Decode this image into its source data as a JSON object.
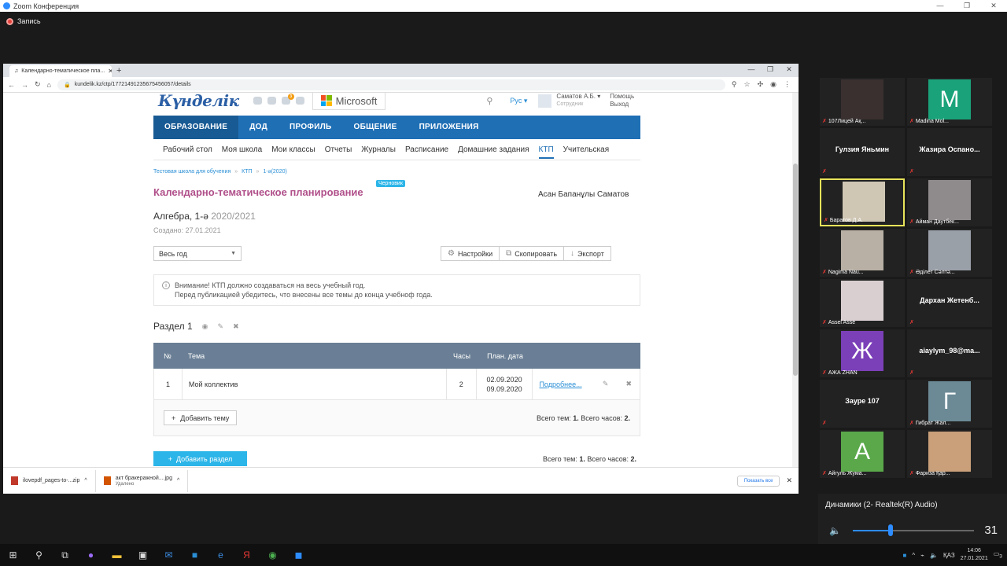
{
  "zoom": {
    "title": "Zoom Конференция",
    "recording": "Запись",
    "speaker_label": "Динамики (2- Realtek(R) Audio)",
    "volume": 31
  },
  "browser": {
    "tab_title": "Календарно-тематическое пла...",
    "url": "kundelik.kz/ctp/17721491235675456057/details",
    "downloads": [
      {
        "name": "ilovepdf_pages-to-...zip",
        "sub": ""
      },
      {
        "name": "акт бракеражной....jpg",
        "sub": "Удалено"
      }
    ],
    "show_all": "Показать все"
  },
  "site": {
    "logo": "Күнделік",
    "microsoft": "Microsoft",
    "lang": "Рус",
    "user_name": "Саматов А.Б.",
    "user_role": "Сотрудник",
    "help": "Помощь",
    "logout": "Выход",
    "notif_count": "3",
    "main_nav": [
      "ОБРАЗОВАНИЕ",
      "ДОД",
      "ПРОФИЛЬ",
      "ОБЩЕНИЕ",
      "ПРИЛОЖЕНИЯ"
    ],
    "sub_nav": [
      "Рабочий стол",
      "Моя школа",
      "Мои классы",
      "Отчеты",
      "Журналы",
      "Расписание",
      "Домашние задания",
      "КТП",
      "Учительская"
    ],
    "breadcrumbs": [
      "Тестовая школа для обучения",
      "КТП",
      "1-ә(2020)"
    ],
    "page_title": "Календарно-тематическое планирование",
    "draft_badge": "Черновик",
    "teacher": "Асан Бапанұлы Саматов",
    "subject": "Алгебра, 1-ә",
    "year": "2020/2021",
    "created": "Создано: 27.01.2021",
    "period_select": "Весь год",
    "actions": [
      "Настройки",
      "Скопировать",
      "Экспорт"
    ],
    "notice_line1": "Внимание! КТП должно создаваться на весь учебный год.",
    "notice_line2": "Перед публикацией убедитесь, что внесены все темы до конца учебноф года.",
    "section_title": "Раздел 1",
    "table_headers": [
      "№",
      "Тема",
      "Часы",
      "План. дата"
    ],
    "rows": [
      {
        "num": "1",
        "topic": "Мой коллектив",
        "hours": "2",
        "date1": "02.09.2020",
        "date2": "09.09.2020",
        "link": "Подробнее..."
      }
    ],
    "add_topic": "Добавить тему",
    "section_total_prefix": "Всего тем: ",
    "section_total_topics": "1.",
    "section_total_hours_prefix": " Всего часов: ",
    "section_total_hours": "2.",
    "add_section": "Добавить раздел"
  },
  "participants": [
    {
      "name": "107Лицей Ақ...",
      "type": "photo",
      "color": "#3a3030"
    },
    {
      "name": "Madina Mol...",
      "type": "letter",
      "letter": "M",
      "color": "#1aa37a"
    },
    {
      "name": "",
      "type": "name",
      "center": "Гулзия Яньмин"
    },
    {
      "name": "",
      "type": "name",
      "center": "Жазира  Оспано..."
    },
    {
      "name": "Баратов Д.А.",
      "type": "photo",
      "color": "#cfc6b4",
      "active": true
    },
    {
      "name": "Айман Даутбек...",
      "type": "photo",
      "color": "#8f8a8c"
    },
    {
      "name": "Nagima Nau...",
      "type": "photo",
      "color": "#b8b0a5"
    },
    {
      "name": "Әділет Сәлтә...",
      "type": "photo",
      "color": "#9aa0a8"
    },
    {
      "name": "Assel Asse",
      "type": "photo",
      "color": "#d9cfd1"
    },
    {
      "name": "",
      "type": "name",
      "center": "Дархан  Жетенб..."
    },
    {
      "name": "АЖА ZHAN",
      "type": "letter",
      "letter": "Ж",
      "color": "#7b3fb8"
    },
    {
      "name": "",
      "type": "name",
      "center": "aiaylym_98@ma..."
    },
    {
      "name": "",
      "type": "name",
      "center": "Зауре 107"
    },
    {
      "name": "Гибрат Жал...",
      "type": "letter",
      "letter": "Г",
      "color": "#6b8a96"
    },
    {
      "name": "Айгуль Жума...",
      "type": "letter",
      "letter": "А",
      "color": "#5aa84a"
    },
    {
      "name": "Фариза Қар...",
      "type": "photo",
      "color": "#c9a07a"
    }
  ],
  "taskbar": {
    "lang": "ҚАЗ",
    "time": "14:06",
    "date": "27.01.2021",
    "notif": "3"
  }
}
